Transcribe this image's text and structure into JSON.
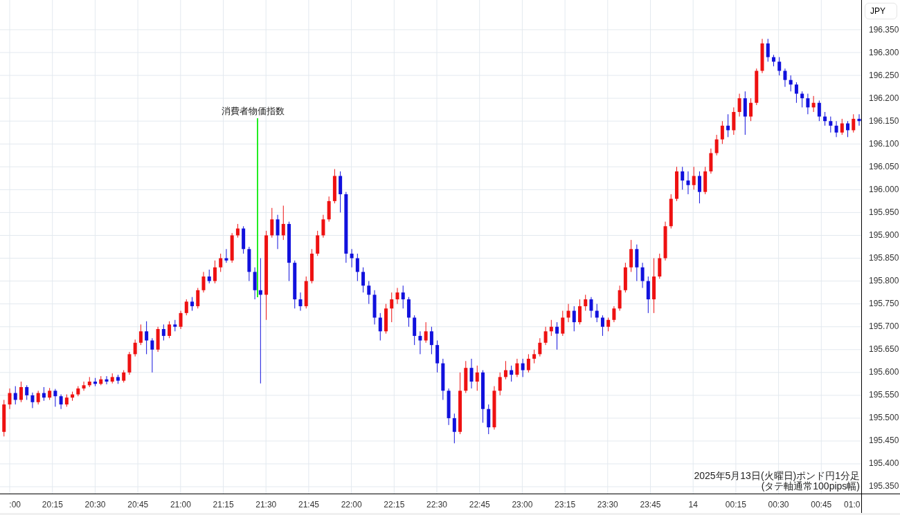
{
  "price_axis": {
    "currency": "JPY"
  },
  "time_axis": {
    "labels": [
      ":00",
      "20:15",
      "20:30",
      "20:45",
      "21:00",
      "21:15",
      "21:30",
      "21:45",
      "22:00",
      "22:15",
      "22:30",
      "22:45",
      "23:00",
      "23:15",
      "23:30",
      "23:45",
      "14",
      "00:15",
      "00:30",
      "00:45",
      "01:0"
    ]
  },
  "chart_data": {
    "type": "candlestick",
    "grid": true,
    "ylim": [
      195.335,
      196.415
    ],
    "categories": [
      null,
      null,
      null,
      null,
      null,
      null,
      null,
      null,
      null,
      null,
      null,
      null,
      null,
      null,
      null,
      null,
      null,
      null,
      null,
      null,
      null,
      null,
      null,
      null,
      null,
      null,
      null,
      null,
      null,
      null,
      null,
      null,
      null,
      null,
      null,
      null,
      null,
      null,
      null,
      null,
      null,
      null,
      null,
      null,
      null,
      null,
      null,
      null,
      null,
      null,
      null,
      null,
      null,
      null,
      null,
      null,
      null,
      null,
      null,
      null,
      null,
      null,
      null,
      null,
      null,
      null,
      null,
      null,
      null,
      null,
      null,
      null,
      null,
      null,
      null,
      null,
      null,
      null,
      null,
      null,
      null,
      null,
      null,
      null,
      null,
      null,
      null,
      null,
      null,
      null,
      null,
      null,
      null,
      null,
      null,
      null,
      null,
      null,
      null,
      null,
      null,
      null,
      null,
      null,
      null,
      null,
      null,
      null,
      null,
      null,
      null,
      null,
      null,
      null,
      null,
      null,
      null,
      null,
      null,
      null,
      null,
      null,
      null,
      null,
      null,
      null,
      null,
      null,
      null,
      null,
      null,
      null,
      null,
      null,
      null,
      null,
      null,
      null,
      null,
      null,
      null,
      null,
      null,
      null,
      null,
      null,
      null,
      null,
      null,
      null,
      null
    ],
    "ohlc": [
      [
        195.47,
        195.54,
        195.46,
        195.53
      ],
      [
        195.53,
        195.565,
        195.52,
        195.555
      ],
      [
        195.555,
        195.57,
        195.53,
        195.54
      ],
      [
        195.54,
        195.58,
        195.535,
        195.568
      ],
      [
        195.568,
        195.572,
        195.54,
        195.55
      ],
      [
        195.55,
        195.556,
        195.522,
        195.535
      ],
      [
        195.535,
        195.56,
        195.53,
        195.555
      ],
      [
        195.555,
        195.568,
        195.538,
        195.545
      ],
      [
        195.545,
        195.566,
        195.54,
        195.56
      ],
      [
        195.56,
        195.564,
        195.525,
        195.548
      ],
      [
        195.548,
        195.552,
        195.52,
        195.53
      ],
      [
        195.53,
        195.552,
        195.525,
        195.545
      ],
      [
        195.545,
        195.558,
        195.538,
        195.552
      ],
      [
        195.552,
        195.57,
        195.548,
        195.565
      ],
      [
        195.565,
        195.58,
        195.56,
        195.572
      ],
      [
        195.572,
        195.59,
        195.568,
        195.58
      ],
      [
        195.58,
        195.588,
        195.57,
        195.575
      ],
      [
        195.575,
        195.592,
        195.572,
        195.585
      ],
      [
        195.585,
        195.592,
        195.574,
        195.58
      ],
      [
        195.58,
        195.598,
        195.576,
        195.59
      ],
      [
        195.59,
        195.595,
        195.575,
        195.582
      ],
      [
        195.582,
        195.605,
        195.578,
        195.6
      ],
      [
        195.6,
        195.645,
        195.595,
        195.64
      ],
      [
        195.64,
        195.672,
        195.635,
        195.665
      ],
      [
        195.665,
        195.705,
        195.66,
        195.69
      ],
      [
        195.69,
        195.712,
        195.64,
        195.67
      ],
      [
        195.67,
        195.675,
        195.6,
        195.65
      ],
      [
        195.65,
        195.7,
        195.645,
        195.695
      ],
      [
        195.695,
        195.705,
        195.67,
        195.68
      ],
      [
        195.68,
        195.712,
        195.675,
        195.705
      ],
      [
        195.705,
        195.715,
        195.69,
        195.7
      ],
      [
        195.7,
        195.735,
        195.695,
        195.73
      ],
      [
        195.73,
        195.76,
        195.725,
        195.755
      ],
      [
        195.755,
        195.765,
        195.735,
        195.745
      ],
      [
        195.745,
        195.785,
        195.74,
        195.78
      ],
      [
        195.78,
        195.82,
        195.775,
        195.81
      ],
      [
        195.81,
        195.825,
        195.795,
        195.8
      ],
      [
        195.8,
        195.845,
        195.795,
        195.83
      ],
      [
        195.83,
        195.86,
        195.82,
        195.85
      ],
      [
        195.85,
        195.87,
        195.84,
        195.845
      ],
      [
        195.845,
        195.905,
        195.84,
        195.9
      ],
      [
        195.9,
        195.925,
        195.895,
        195.915
      ],
      [
        195.915,
        195.92,
        195.86,
        195.87
      ],
      [
        195.87,
        195.875,
        195.8,
        195.82
      ],
      [
        195.82,
        195.83,
        195.76,
        195.78
      ],
      [
        195.78,
        195.85,
        195.576,
        195.77
      ],
      [
        195.77,
        195.91,
        195.715,
        195.9
      ],
      [
        195.9,
        195.96,
        195.895,
        195.935
      ],
      [
        195.935,
        195.945,
        195.87,
        195.9
      ],
      [
        195.9,
        195.965,
        195.89,
        195.925
      ],
      [
        195.925,
        195.93,
        195.8,
        195.84
      ],
      [
        195.84,
        195.845,
        195.74,
        195.76
      ],
      [
        195.76,
        195.775,
        195.735,
        195.745
      ],
      [
        195.745,
        195.81,
        195.74,
        195.8
      ],
      [
        195.8,
        195.87,
        195.795,
        195.86
      ],
      [
        195.86,
        195.91,
        195.855,
        195.9
      ],
      [
        195.9,
        195.945,
        195.895,
        195.935
      ],
      [
        195.935,
        195.985,
        195.93,
        195.975
      ],
      [
        195.975,
        196.045,
        195.97,
        196.03
      ],
      [
        196.03,
        196.04,
        195.95,
        195.99
      ],
      [
        195.99,
        195.995,
        195.84,
        195.86
      ],
      [
        195.86,
        195.87,
        195.83,
        195.85
      ],
      [
        195.85,
        195.86,
        195.8,
        195.82
      ],
      [
        195.82,
        195.83,
        195.775,
        195.79
      ],
      [
        195.79,
        195.8,
        195.75,
        195.77
      ],
      [
        195.77,
        195.78,
        195.705,
        195.72
      ],
      [
        195.72,
        195.73,
        195.67,
        195.69
      ],
      [
        195.69,
        195.75,
        195.685,
        195.74
      ],
      [
        195.74,
        195.775,
        195.71,
        195.76
      ],
      [
        195.76,
        195.785,
        195.75,
        195.775
      ],
      [
        195.775,
        195.79,
        195.74,
        195.76
      ],
      [
        195.76,
        195.765,
        195.7,
        195.72
      ],
      [
        195.72,
        195.725,
        195.66,
        195.68
      ],
      [
        195.68,
        195.69,
        195.64,
        195.67
      ],
      [
        195.67,
        195.71,
        195.665,
        195.69
      ],
      [
        195.69,
        195.7,
        195.64,
        195.66
      ],
      [
        195.66,
        195.67,
        195.6,
        195.62
      ],
      [
        195.62,
        195.63,
        195.54,
        195.56
      ],
      [
        195.56,
        195.565,
        195.485,
        195.5
      ],
      [
        195.5,
        195.51,
        195.445,
        195.47
      ],
      [
        195.47,
        195.6,
        195.465,
        195.56
      ],
      [
        195.56,
        195.625,
        195.555,
        195.61
      ],
      [
        195.61,
        195.63,
        195.565,
        195.58
      ],
      [
        195.58,
        195.615,
        195.56,
        195.6
      ],
      [
        195.6,
        195.605,
        195.49,
        195.52
      ],
      [
        195.52,
        195.53,
        195.465,
        195.48
      ],
      [
        195.48,
        195.57,
        195.475,
        195.56
      ],
      [
        195.56,
        195.6,
        195.55,
        195.59
      ],
      [
        195.59,
        195.625,
        195.585,
        195.605
      ],
      [
        195.605,
        195.615,
        195.58,
        195.595
      ],
      [
        195.595,
        195.63,
        195.59,
        195.62
      ],
      [
        195.62,
        195.63,
        195.59,
        195.605
      ],
      [
        195.605,
        195.64,
        195.6,
        195.63
      ],
      [
        195.63,
        195.65,
        195.62,
        195.64
      ],
      [
        195.64,
        195.675,
        195.635,
        195.665
      ],
      [
        195.665,
        195.7,
        195.66,
        195.69
      ],
      [
        195.69,
        195.715,
        195.68,
        195.7
      ],
      [
        195.7,
        195.71,
        195.65,
        195.685
      ],
      [
        195.685,
        195.735,
        195.68,
        195.72
      ],
      [
        195.72,
        195.75,
        195.71,
        195.735
      ],
      [
        195.735,
        195.745,
        195.69,
        195.71
      ],
      [
        195.71,
        195.76,
        195.705,
        195.745
      ],
      [
        195.745,
        195.77,
        195.735,
        195.76
      ],
      [
        195.76,
        195.765,
        195.72,
        195.735
      ],
      [
        195.735,
        195.75,
        195.71,
        195.72
      ],
      [
        195.72,
        195.725,
        195.68,
        195.7
      ],
      [
        195.7,
        195.72,
        195.69,
        195.715
      ],
      [
        195.715,
        195.745,
        195.71,
        195.74
      ],
      [
        195.74,
        195.79,
        195.735,
        195.78
      ],
      [
        195.78,
        195.84,
        195.775,
        195.83
      ],
      [
        195.83,
        195.89,
        195.82,
        195.87
      ],
      [
        195.87,
        195.88,
        195.8,
        195.83
      ],
      [
        195.83,
        195.84,
        195.785,
        195.8
      ],
      [
        195.8,
        195.81,
        195.73,
        195.76
      ],
      [
        195.76,
        195.85,
        195.73,
        195.81
      ],
      [
        195.81,
        195.86,
        195.805,
        195.85
      ],
      [
        195.85,
        195.93,
        195.845,
        195.92
      ],
      [
        195.92,
        195.99,
        195.915,
        195.98
      ],
      [
        195.98,
        196.05,
        195.975,
        196.04
      ],
      [
        196.04,
        196.05,
        196.0,
        196.02
      ],
      [
        196.02,
        196.04,
        195.99,
        196.01
      ],
      [
        196.01,
        196.05,
        196.0,
        196.03
      ],
      [
        196.03,
        196.04,
        195.97,
        195.995
      ],
      [
        195.995,
        196.05,
        195.99,
        196.04
      ],
      [
        196.04,
        196.09,
        196.035,
        196.08
      ],
      [
        196.08,
        196.12,
        196.075,
        196.11
      ],
      [
        196.11,
        196.15,
        196.1,
        196.14
      ],
      [
        196.14,
        196.165,
        196.115,
        196.13
      ],
      [
        196.13,
        196.18,
        196.12,
        196.17
      ],
      [
        196.17,
        196.21,
        196.16,
        196.2
      ],
      [
        196.2,
        196.215,
        196.12,
        196.16
      ],
      [
        196.16,
        196.2,
        196.15,
        196.19
      ],
      [
        196.19,
        196.265,
        196.185,
        196.26
      ],
      [
        196.26,
        196.33,
        196.255,
        196.32
      ],
      [
        196.32,
        196.33,
        196.28,
        196.29
      ],
      [
        196.29,
        196.295,
        196.27,
        196.28
      ],
      [
        196.28,
        196.29,
        196.25,
        196.26
      ],
      [
        196.26,
        196.265,
        196.225,
        196.24
      ],
      [
        196.24,
        196.25,
        196.215,
        196.23
      ],
      [
        196.23,
        196.235,
        196.19,
        196.21
      ],
      [
        196.21,
        196.215,
        196.18,
        196.2
      ],
      [
        196.2,
        196.21,
        196.165,
        196.18
      ],
      [
        196.18,
        196.205,
        196.17,
        196.19
      ],
      [
        196.19,
        196.195,
        196.15,
        196.16
      ],
      [
        196.16,
        196.17,
        196.14,
        196.15
      ],
      [
        196.15,
        196.16,
        196.125,
        196.14
      ],
      [
        196.14,
        196.15,
        196.115,
        196.125
      ],
      [
        196.125,
        196.155,
        196.12,
        196.145
      ],
      [
        196.145,
        196.15,
        196.115,
        196.13
      ],
      [
        196.13,
        196.165,
        196.125,
        196.155
      ],
      [
        196.155,
        196.165,
        196.14,
        196.15
      ]
    ],
    "yticks": [
      {
        "value": 196.35,
        "label": "196.350"
      },
      {
        "value": 196.3,
        "label": "196.300"
      },
      {
        "value": 196.25,
        "label": "196.250"
      },
      {
        "value": 196.2,
        "label": "196.200"
      },
      {
        "value": 196.15,
        "label": "196.150"
      },
      {
        "value": 196.1,
        "label": "196.100"
      },
      {
        "value": 196.05,
        "label": "196.050"
      },
      {
        "value": 196.0,
        "label": "196.000"
      },
      {
        "value": 195.95,
        "label": "195.950"
      },
      {
        "value": 195.9,
        "label": "195.900"
      },
      {
        "value": 195.85,
        "label": "195.850"
      },
      {
        "value": 195.8,
        "label": "195.800"
      },
      {
        "value": 195.75,
        "label": "195.750"
      },
      {
        "value": 195.7,
        "label": "195.700"
      },
      {
        "value": 195.65,
        "label": "195.650"
      },
      {
        "value": 195.6,
        "label": "195.600"
      },
      {
        "value": 195.55,
        "label": "195.550"
      },
      {
        "value": 195.5,
        "label": "195.500"
      },
      {
        "value": 195.45,
        "label": "195.450"
      },
      {
        "value": 195.4,
        "label": "195.400"
      },
      {
        "value": 195.35,
        "label": "195.350"
      }
    ],
    "annotations": [
      {
        "text": "消費者物価指数"
      }
    ]
  },
  "caption": {
    "lines": [
      "2025年5月13日(火曜日)ポンド円1分足",
      "(タテ軸通常100pips幅)"
    ]
  }
}
